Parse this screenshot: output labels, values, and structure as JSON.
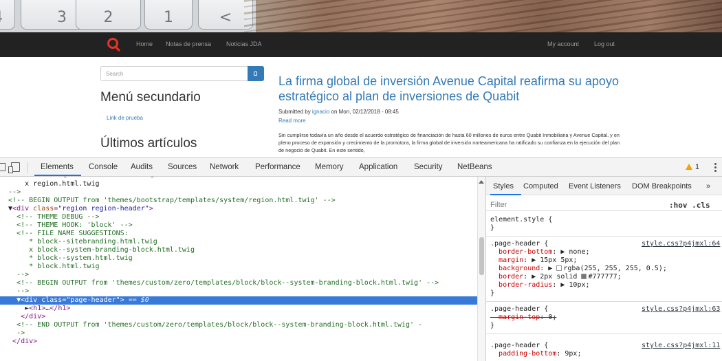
{
  "hero": {
    "keys": [
      "4",
      "3",
      "2",
      "1",
      "<"
    ]
  },
  "site_nav": {
    "links": [
      "Home",
      "Notas de prensa",
      "Noticias JDA"
    ],
    "right_links": [
      "My account",
      "Log out"
    ]
  },
  "sidebar": {
    "search_placeholder": "Search",
    "menu_heading": "Menú secundario",
    "menu_link": "Link de prueba",
    "latest_heading": "Últimos artículos"
  },
  "article": {
    "title": "La firma global de inversión Avenue Capital reafirma su apoyo estratégico al plan de inversiones de Quabit",
    "submitted_prefix": "Submitted by ",
    "author": "ignacio",
    "submitted_suffix": " on Mon, 02/12/2018 - 08:45",
    "read_more": "Read more",
    "body": "Sin cumplirse todavía un año desde el acuerdo estratégico de financiación de hasta 60 millones de euros entre Quabit Inmobiliaria y Avenue Capital, y en pleno proceso de expansión y crecimiento de la promotora, la firma global de inversión norteamericana ha ratificado su confianza en la ejecución del plan de negocio de Quabit. En este sentido,"
  },
  "devtools": {
    "tabs": [
      "Elements",
      "Console",
      "Audits",
      "Sources",
      "Network",
      "Performance",
      "Memory",
      "Application",
      "Security",
      "NetBeans"
    ],
    "active_tab": "Elements",
    "warning_count": "1",
    "elements_lines": [
      "      x region.html.twig",
      "  -->",
      "  <!-- BEGIN OUTPUT from 'themes/bootstrap/templates/system/region.html.twig' -->",
      "▼<div class=\"region region-header\">",
      "    <!-- THEME DEBUG -->",
      "    <!-- THEME HOOK: 'block' -->",
      "    <!-- FILE NAME SUGGESTIONS:",
      "       * block--sitebranding.html.twig",
      "       x block--system-branding-block.html.twig",
      "       * block--system.html.twig",
      "       * block.html.twig",
      "    -->",
      "    <!-- BEGIN OUTPUT from 'themes/custom/zero/templates/block/block--system-branding-block.html.twig' -->",
      "    -->",
      "  ▼<div class=\"page-header\"> == $0",
      "      ►<h1>…</h1>",
      "    </div>",
      "    <!-- END OUTPUT from 'themes/custom/zero/templates/block/block--system-branding-block.html.twig' -",
      "    ->",
      "  </div>"
    ],
    "styles": {
      "tabs": [
        "Styles",
        "Computed",
        "Event Listeners",
        "DOM Breakpoints",
        "»"
      ],
      "filter_placeholder": "Filter",
      "hov": ":hov",
      "cls": ".cls",
      "element_style": "element.style {",
      "close_brace": "}",
      "rule1": {
        "selector": ".page-header {",
        "source": "style.css?p4jmxl:64",
        "props": [
          {
            "name": "border-bottom",
            "value": "▶ none;"
          },
          {
            "name": "margin",
            "value": "▶ 15px 5px;"
          },
          {
            "name": "background",
            "value": "rgba(255, 255, 255, 0.5);"
          },
          {
            "name": "border",
            "value": "▶ 2px solid ",
            "value2": "#777777;"
          },
          {
            "name": "border-radius",
            "value": "▶ 10px;"
          }
        ]
      },
      "rule2": {
        "selector": ".page-header {",
        "source": "style.css?p4jmxl:63",
        "props": [
          {
            "name": "margin-top",
            "value": "0;"
          }
        ]
      },
      "rule3": {
        "selector": ".page-header {",
        "source": "style.css?p4jmxl:11",
        "props": [
          {
            "name": "padding-bottom",
            "value": "9px;"
          }
        ]
      }
    }
  },
  "colors": {
    "link": "#337ab7",
    "selected_row": "#3879d9",
    "comment": "#236e25",
    "tag": "#881280",
    "warning": "#f0a500",
    "border_swatch": "#777777"
  }
}
